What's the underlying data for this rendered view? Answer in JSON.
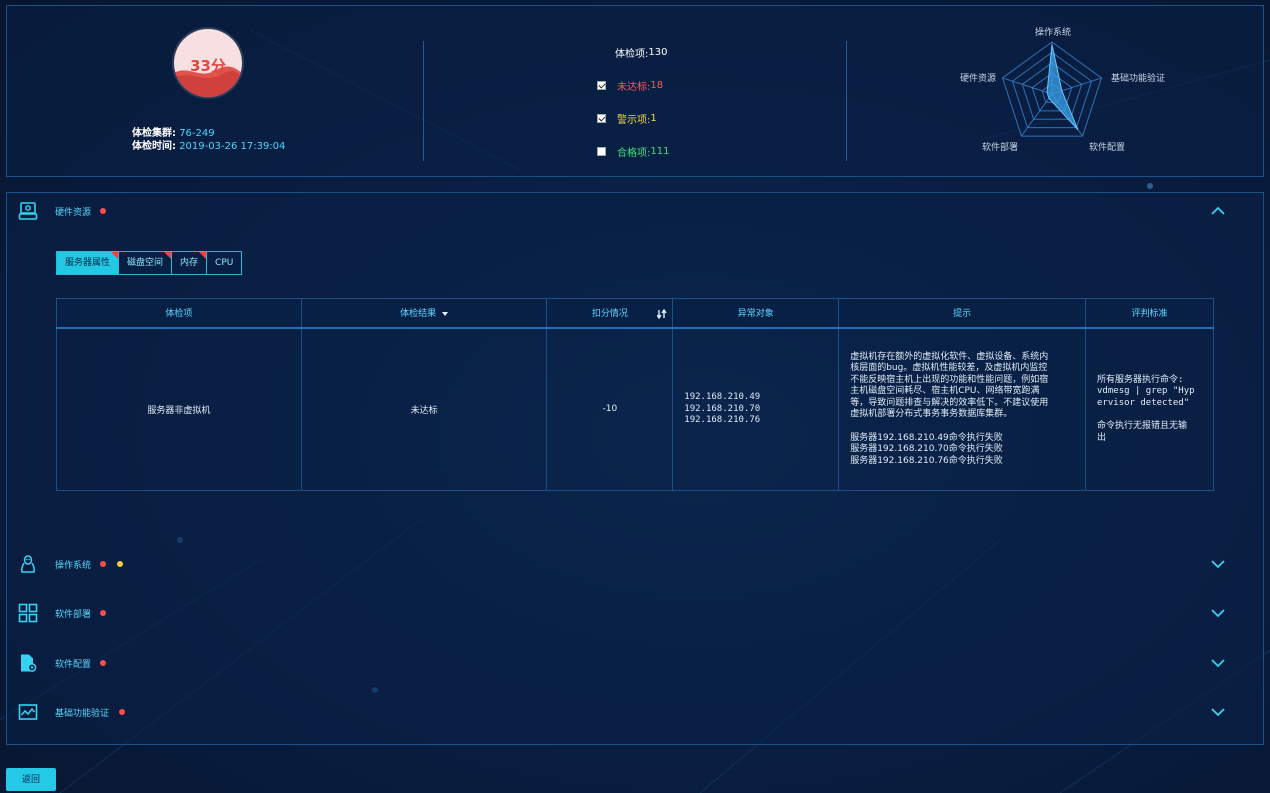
{
  "summary": {
    "score": "33分",
    "cluster_label": "体检集群:",
    "cluster_value": "76-249",
    "time_label": "体检时间:",
    "time_value": "2019-03-26 17:39:04",
    "total_label": "体检项:",
    "total_value": "130",
    "stats": [
      {
        "label": "未达标:",
        "value": "18",
        "checked": true,
        "color": "#ff5a5a"
      },
      {
        "label": "警示项:",
        "value": "1",
        "checked": true,
        "color": "#f6d44a"
      },
      {
        "label": "合格项:",
        "value": "111",
        "checked": false,
        "color": "#3ee07a"
      }
    ],
    "radar": {
      "axes": [
        "操作系统",
        "基础功能验证",
        "软件配置",
        "软件部署",
        "硬件资源"
      ],
      "values": [
        0.95,
        0.2,
        0.85,
        0.1,
        0.1
      ],
      "colors": {
        "grid": "#2f72b8",
        "fill": "#3aa0e8"
      }
    }
  },
  "sections": [
    {
      "title": "硬件资源",
      "icon": "hardware-icon",
      "dots": [
        "#ff4d4d"
      ],
      "expanded": true
    },
    {
      "title": "操作系统",
      "icon": "linux-icon",
      "dots": [
        "#ff4d4d",
        "#f2cc3a"
      ],
      "expanded": false
    },
    {
      "title": "软件部署",
      "icon": "grid-icon",
      "dots": [
        "#ff4d4d"
      ],
      "expanded": false
    },
    {
      "title": "软件配置",
      "icon": "config-icon",
      "dots": [
        "#ff4d4d"
      ],
      "expanded": false
    },
    {
      "title": "基础功能验证",
      "icon": "monitor-icon",
      "dots": [
        "#ff4d4d"
      ],
      "expanded": false
    }
  ],
  "tabs": [
    {
      "label": "服务器属性",
      "active": true,
      "flag": true
    },
    {
      "label": "磁盘空间",
      "active": false,
      "flag": true
    },
    {
      "label": "内存",
      "active": false,
      "flag": true
    },
    {
      "label": "CPU",
      "active": false,
      "flag": false
    }
  ],
  "table": {
    "headers": [
      "体检项",
      "体检结果",
      "扣分情况",
      "异常对象",
      "提示",
      "评判标准"
    ],
    "row": {
      "item": "服务器非虚拟机",
      "result": "未达标",
      "deduction": "-10",
      "objects": [
        "192.168.210.49",
        "192.168.210.70",
        "192.168.210.76"
      ],
      "hint_lines": [
        "虚拟机存在额外的虚拟化软件、虚拟设备、系统内",
        "核层面的bug。虚拟机性能较差，及虚拟机内监控",
        "不能反映宿主机上出现的功能和性能问题，例如宿",
        "主机磁盘空间耗尽、宿主机CPU、网络带宽跑满",
        "等，导致问题排查与解决的效率低下。不建议使用",
        "虚拟机部署分布式事务事务数据库集群。"
      ],
      "hint_failures": [
        "服务器192.168.210.49命令执行失败",
        "服务器192.168.210.70命令执行失败",
        "服务器192.168.210.76命令执行失败"
      ],
      "criteria_lines": [
        "所有服务器执行命令:",
        "vdmesg | grep \"Hyp",
        "ervisor detected\""
      ],
      "criteria_note_lines": [
        "命令执行无报错且无输",
        "出"
      ]
    }
  },
  "back_label": "返回"
}
